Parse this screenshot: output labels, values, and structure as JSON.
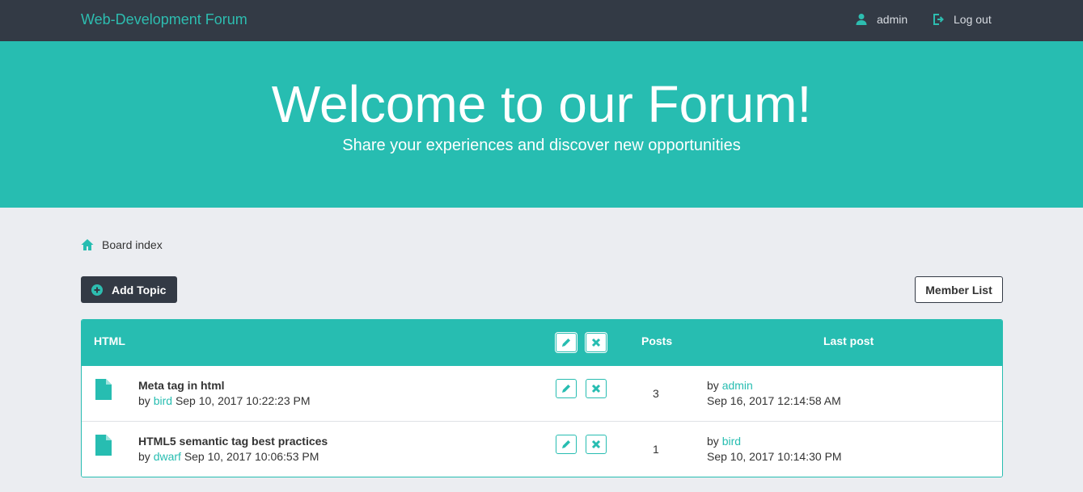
{
  "navbar": {
    "brand": "Web-Development Forum",
    "username": "admin",
    "logout_label": "Log out"
  },
  "hero": {
    "title": "Welcome to our Forum!",
    "subtitle": "Share your experiences and discover new opportunities"
  },
  "breadcrumb": {
    "label": "Board index"
  },
  "actions": {
    "add_topic_label": "Add Topic",
    "member_list_label": "Member List"
  },
  "forum": {
    "name": "HTML",
    "posts_header": "Posts",
    "last_post_header": "Last post",
    "topics": [
      {
        "title": "Meta tag in html",
        "by_prefix": "by",
        "author": "bird",
        "created": "Sep 10, 2017 10:22:23 PM",
        "posts": "3",
        "last_by_prefix": "by",
        "last_author": "admin",
        "last_date": "Sep 16, 2017 12:14:58 AM"
      },
      {
        "title": "HTML5 semantic tag best practices",
        "by_prefix": "by",
        "author": "dwarf",
        "created": "Sep 10, 2017 10:06:53 PM",
        "posts": "1",
        "last_by_prefix": "by",
        "last_author": "bird",
        "last_date": "Sep 10, 2017 10:14:30 PM"
      }
    ]
  },
  "icons": {
    "user": "user-icon",
    "logout": "logout-icon",
    "home": "home-icon",
    "add": "plus-circle-icon",
    "edit": "pencil-icon",
    "delete": "close-icon",
    "topic": "file-icon"
  },
  "colors": {
    "accent": "#27bdb1",
    "dark": "#333a45",
    "background": "#ebedf1"
  }
}
